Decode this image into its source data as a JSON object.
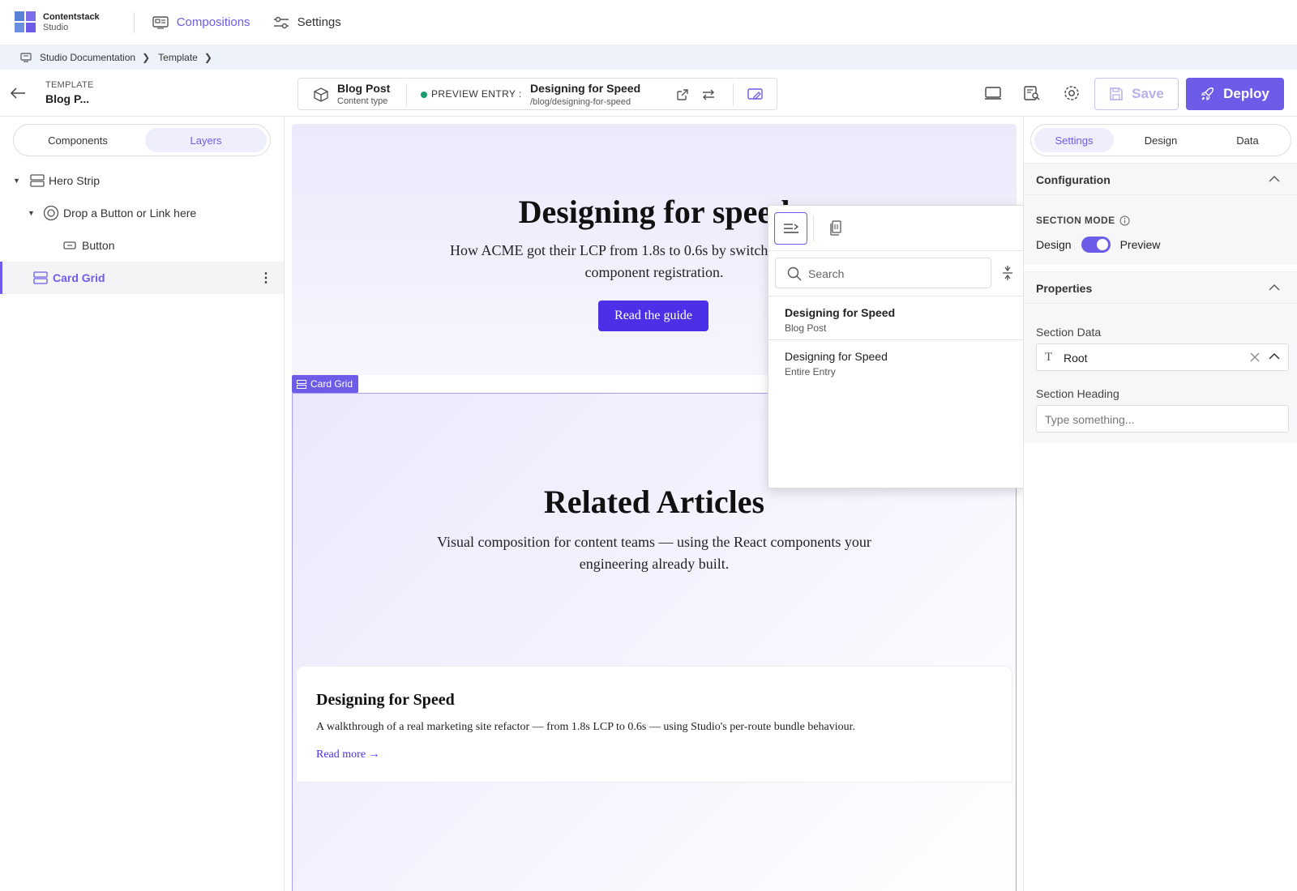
{
  "app": {
    "brand_line1": "Contentstack",
    "brand_line2": "Studio"
  },
  "nav": {
    "compositions": "Compositions",
    "settings": "Settings"
  },
  "breadcrumb": {
    "items": [
      "Studio Documentation",
      "Template"
    ]
  },
  "toolbar": {
    "template_label": "TEMPLATE",
    "template_name": "Blog P...",
    "content_type_name": "Blog Post",
    "content_type_sub": "Content type",
    "preview_label": "PREVIEW ENTRY :",
    "entry_title": "Designing for Speed",
    "entry_url": "/blog/designing-for-speed",
    "save_label": "Save",
    "deploy_label": "Deploy"
  },
  "left_panel": {
    "tabs": [
      "Components",
      "Layers"
    ],
    "active_tab": "Layers",
    "layers": [
      {
        "label": "Hero Strip",
        "depth": 0,
        "expanded": true,
        "icon": "section-icon"
      },
      {
        "label": "Drop a Button or Link here",
        "depth": 1,
        "expanded": true,
        "icon": "slot-icon"
      },
      {
        "label": "Button",
        "depth": 2,
        "icon": "button-icon"
      },
      {
        "label": "Card Grid",
        "depth": 0,
        "selected": true,
        "icon": "section-icon"
      }
    ]
  },
  "canvas": {
    "hero": {
      "title": "Designing for speed",
      "subtitle": "How ACME got their LCP from 1.8s to 0.6s by switching to per-route component registration.",
      "button": "Read the guide"
    },
    "card_grid_tag": "Card Grid",
    "card_grid": {
      "title": "Related Articles",
      "subtitle": "Visual composition for content teams — using the React components your engineering already built.",
      "card": {
        "title": "Designing for Speed",
        "desc": "A walkthrough of a real marketing site refactor — from 1.8s LCP to 0.6s — using Studio's per-route bundle behaviour.",
        "link": "Read more →"
      }
    }
  },
  "popup": {
    "search_placeholder": "Search",
    "items": [
      {
        "title": "Designing for Speed",
        "sub": "Blog Post"
      },
      {
        "title": "Designing for Speed",
        "sub": "Entire Entry"
      }
    ]
  },
  "right_panel": {
    "tabs": [
      "Settings",
      "Design",
      "Data"
    ],
    "active_tab": "Settings",
    "configuration": "Configuration",
    "section_mode_label": "SECTION MODE",
    "mode_left": "Design",
    "mode_right": "Preview",
    "mode_preview_on": true,
    "properties": "Properties",
    "section_data_label": "Section Data",
    "section_data_value": "Root",
    "section_heading_label": "Section Heading",
    "section_heading_placeholder": "Type something..."
  },
  "colors": {
    "accent": "#6c5ce7",
    "button": "#4b30e8",
    "status_dot": "#1a9c6f"
  }
}
